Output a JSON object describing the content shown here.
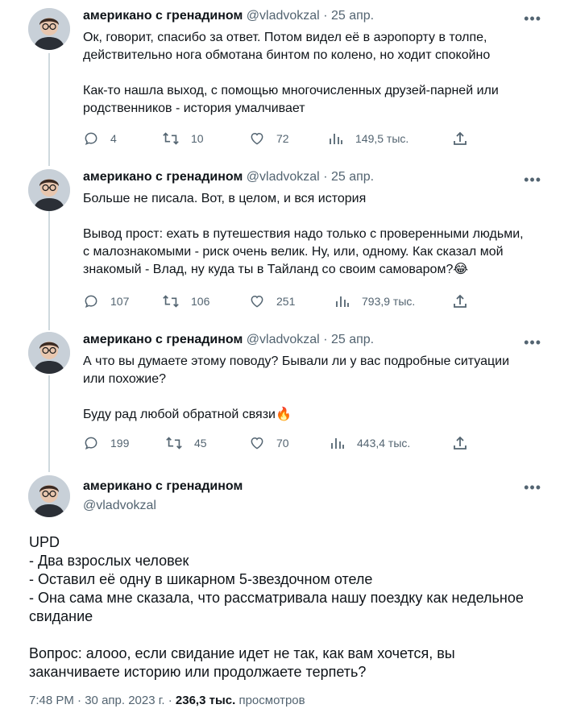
{
  "author": {
    "name": "американо с гренадином",
    "handle": "@vladvokzal"
  },
  "tweets": [
    {
      "date": "25 апр.",
      "paragraphs": [
        "Ок, говорит, спасибо за ответ. Потом видел её в аэропорту в толпе, действительно нога обмотана бинтом по колено, но ходит спокойно",
        "Как-то нашла выход, с помощью многочисленных друзей-парней или родственников - история умалчивает"
      ],
      "replies": "4",
      "retweets": "10",
      "likes": "72",
      "views": "149,5 тыс."
    },
    {
      "date": "25 апр.",
      "paragraphs": [
        "Больше не писала. Вот, в целом, и вся история",
        "Вывод прост: ехать в путешествия надо только с проверенными людьми, с малознакомыми - риск очень велик. Ну, или, одному. Как сказал мой знакомый - Влад, ну куда ты в Тайланд со своим самоваром?😂"
      ],
      "replies": "107",
      "retweets": "106",
      "likes": "251",
      "views": "793,9 тыс."
    },
    {
      "date": "25 апр.",
      "paragraphs": [
        "А что вы думаете этому поводу? Бывали ли у вас подробные ситуации или похожие?",
        "Буду рад любой обратной связи🔥"
      ],
      "replies": "199",
      "retweets": "45",
      "likes": "70",
      "views": "443,4 тыс."
    }
  ],
  "main_tweet": {
    "lines": [
      "UPD",
      "- Два взрослых человек",
      "- Оставил её одну в шикарном 5-звездочном отеле",
      "- Она сама мне сказала, что рассматривала нашу поездку как недельное свидание"
    ],
    "question": "Вопрос: алооо, если свидание идет не так, как вам хочется, вы заканчиваете историю или продолжаете терпеть?",
    "time": "7:48 PM",
    "date": "30 апр. 2023 г.",
    "views_count": "236,3 тыс.",
    "views_label": "просмотров"
  },
  "ui": {
    "sep": "·",
    "more": "•••"
  },
  "colors": {
    "text": "#0f1419",
    "secondary": "#536471",
    "line": "#cfd9de"
  }
}
